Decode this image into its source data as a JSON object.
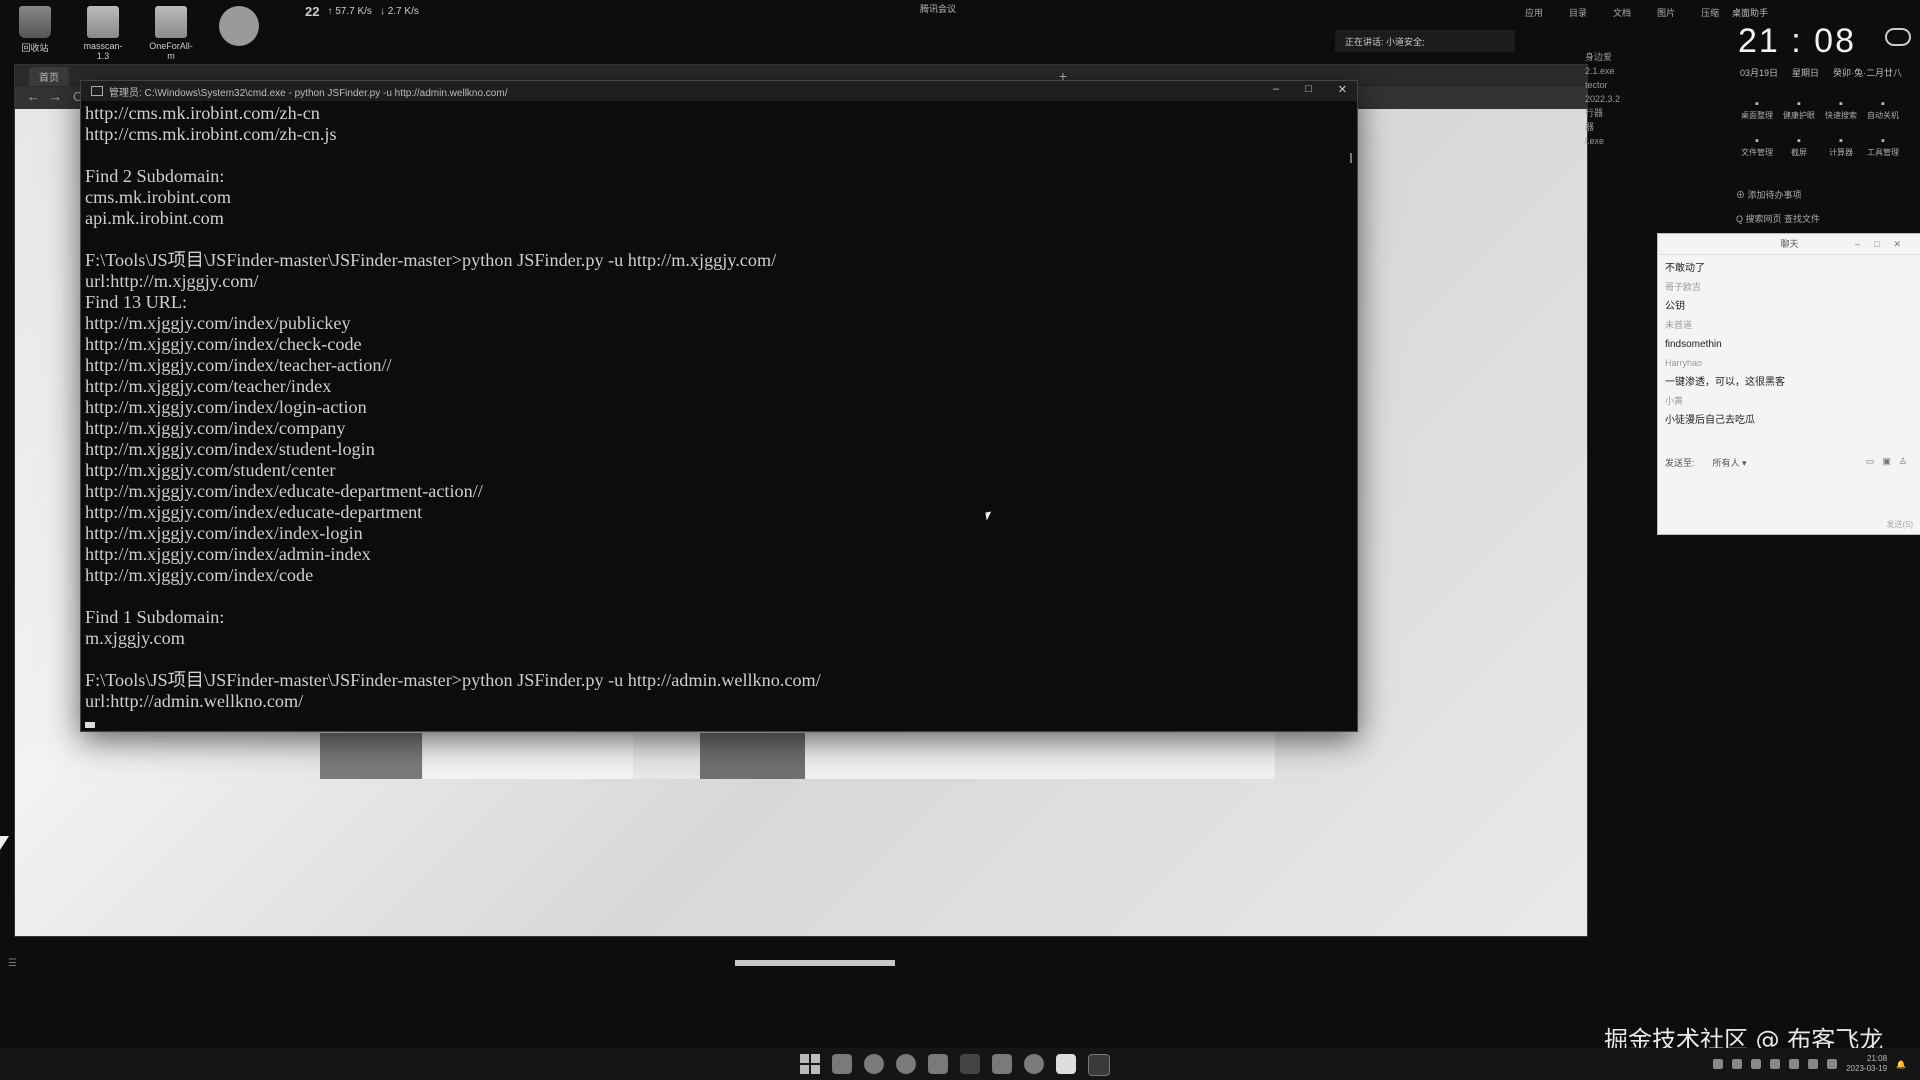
{
  "desktop": {
    "icons": [
      {
        "label": "回收站"
      },
      {
        "label": "masscan-1.3"
      },
      {
        "label": "OneForAll-m"
      },
      {
        "label": ""
      }
    ],
    "weather": {
      "temp": "22",
      "up": "↑ 57.7 K/s",
      "down": "↓ 2.7 K/s"
    },
    "meeting": "腾讯会议"
  },
  "browser": {
    "tab_first": "首页",
    "nav_back": "←",
    "nav_forward": "→",
    "nav_reload": "C",
    "new_tab": "+"
  },
  "cmd": {
    "title": "管理员: C:\\Windows\\System32\\cmd.exe - python  JSFinder.py -u http://admin.wellkno.com/",
    "lines": [
      "http://cms.mk.irobint.com/zh-cn",
      "http://cms.mk.irobint.com/zh-cn.js",
      "",
      "Find 2 Subdomain:",
      "cms.mk.irobint.com",
      "api.mk.irobint.com",
      "",
      "F:\\Tools\\JS项目\\JSFinder-master\\JSFinder-master>python JSFinder.py -u http://m.xjggjy.com/",
      "url:http://m.xjggjy.com/",
      "Find 13 URL:",
      "http://m.xjggjy.com/index/publickey",
      "http://m.xjggjy.com/index/check-code",
      "http://m.xjggjy.com/index/teacher-action//",
      "http://m.xjggjy.com/teacher/index",
      "http://m.xjggjy.com/index/login-action",
      "http://m.xjggjy.com/index/company",
      "http://m.xjggjy.com/index/student-login",
      "http://m.xjggjy.com/student/center",
      "http://m.xjggjy.com/index/educate-department-action//",
      "http://m.xjggjy.com/index/educate-department",
      "http://m.xjggjy.com/index/index-login",
      "http://m.xjggjy.com/index/admin-index",
      "http://m.xjggjy.com/index/code",
      "",
      "Find 1 Subdomain:",
      "m.xjggjy.com",
      "",
      "F:\\Tools\\JS项目\\JSFinder-master\\JSFinder-master>python JSFinder.py -u http://admin.wellkno.com/",
      "url:http://admin.wellkno.com/"
    ],
    "minimize": "–",
    "maximize": "□",
    "close": "✕"
  },
  "widgets": {
    "menu": [
      "应用",
      "目录",
      "文档",
      "图片",
      "压缩"
    ],
    "title": "桌面助手",
    "clock": "21 : 08",
    "clock_sub": [
      "03月19日",
      "星期日",
      "癸卯·兔·二月廿八"
    ],
    "quick": [
      "桌面整理",
      "健康护眼",
      "快速搜索",
      "自动关机",
      "文件管理",
      "截屏",
      "计算器",
      "工具管理"
    ],
    "todo": "⊕ 添加待办事项",
    "search_links": "Q 搜索网页    查找文件",
    "speaking": "正在讲话: 小道安全;",
    "right_strip": [
      "身边爱",
      "2.1.exe",
      "tector",
      "2022.3.2",
      "行器",
      "器",
      "l.exe"
    ]
  },
  "chat": {
    "title": "聊天",
    "messages": [
      {
        "name": "",
        "text": "不敢动了"
      },
      {
        "name": "哥子欧吉",
        "text": "公钥"
      },
      {
        "name": "未首道",
        "text": "findsomethin"
      },
      {
        "name": "Harryhao",
        "text": "一键渗透，可以，这很黑客"
      },
      {
        "name": "小黄",
        "text": "小徒漫后自己去吃瓜"
      }
    ],
    "send_to_label": "发送至:",
    "send_to_value": "所有人 ▾",
    "footer": "发送(S)"
  },
  "watermark": "掘金技术社区 @ 布客飞龙",
  "taskbar": {
    "time": "21:08",
    "date": "2023-03-19"
  }
}
